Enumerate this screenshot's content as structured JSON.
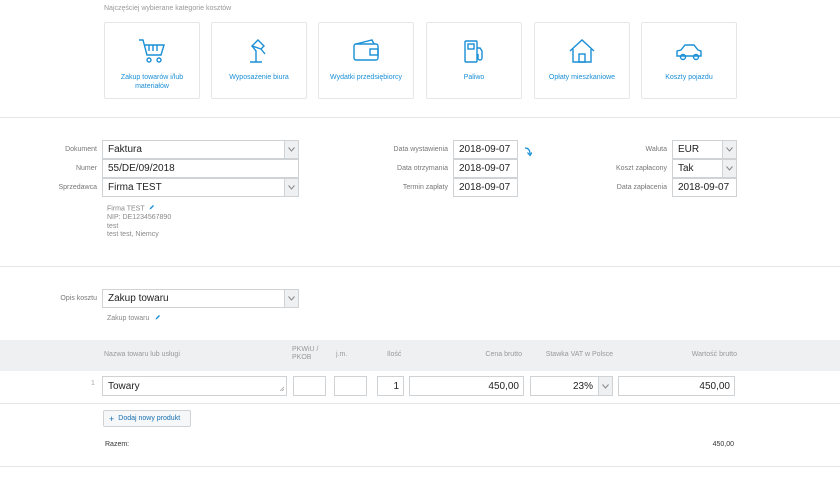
{
  "categories_header": "Najczęściej wybierane kategorie kosztów",
  "categories": [
    {
      "label": "Zakup towarów i/lub materiałów",
      "icon": "shopping-cart-icon"
    },
    {
      "label": "Wyposażenie biura",
      "icon": "desk-lamp-icon"
    },
    {
      "label": "Wydatki przedsiębiorcy",
      "icon": "wallet-icon"
    },
    {
      "label": "Paliwo",
      "icon": "fuel-pump-icon"
    },
    {
      "label": "Opłaty mieszkaniowe",
      "icon": "house-icon"
    },
    {
      "label": "Koszty pojazdu",
      "icon": "car-icon"
    }
  ],
  "document": {
    "document_label": "Dokument",
    "document_value": "Faktura",
    "number_label": "Numer",
    "number_value": "55/DE/09/2018",
    "seller_label": "Sprzedawca",
    "seller_value": "Firma TEST",
    "seller_info": {
      "name": "Firma TEST",
      "nip": "NIP: DE1234567890",
      "line1": "test",
      "line2": "test test, Niemcy"
    }
  },
  "dates": {
    "issue_label": "Data wystawienia",
    "issue_value": "2018-09-07",
    "received_label": "Data otrzymania",
    "received_value": "2018-09-07",
    "due_label": "Termin zapłaty",
    "due_value": "2018-09-07"
  },
  "payment": {
    "currency_label": "Waluta",
    "currency_value": "EUR",
    "paid_label": "Koszt zapłacony",
    "paid_value": "Tak",
    "paid_date_label": "Data zapłacenia",
    "paid_date_value": "2018-09-07"
  },
  "cost_desc": {
    "label": "Opis kosztu",
    "value": "Zakup towaru",
    "note": "Zakup towaru"
  },
  "table": {
    "headers": {
      "name": "Nazwa towaru lub usługi",
      "pkwiu": "PKWiU / PKOB",
      "unit": "j.m.",
      "qty": "Ilość",
      "gross_price": "Cena brutto",
      "vat": "Stawka VAT w Polsce",
      "gross_value": "Wartość brutto"
    },
    "row": {
      "index": "1",
      "name": "Towary",
      "pkwiu": "",
      "unit": "",
      "qty": "1",
      "gross_price": "450,00",
      "vat": "23%",
      "gross_value": "450,00"
    },
    "add_button": "Dodaj nowy produkt",
    "total_label": "Razem:",
    "total_value": "450,00"
  },
  "colors": {
    "accent": "#1a8fd6"
  }
}
